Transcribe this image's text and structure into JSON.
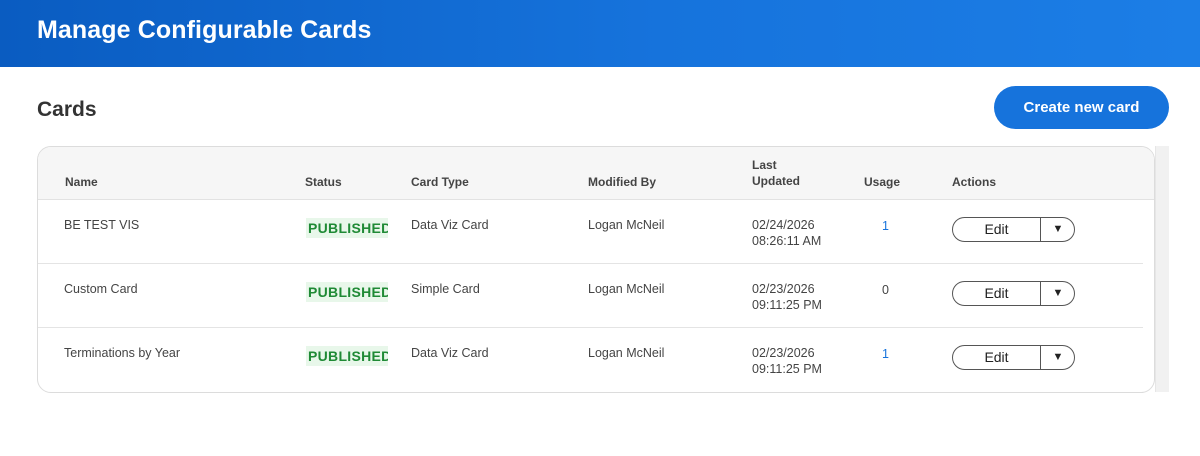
{
  "header": {
    "title": "Manage Configurable Cards"
  },
  "section": {
    "title": "Cards",
    "create_button": "Create new card"
  },
  "table": {
    "columns": {
      "name": "Name",
      "status": "Status",
      "card_type": "Card Type",
      "modified_by": "Modified By",
      "last_updated_line1": "Last",
      "last_updated_line2": "Updated",
      "usage": "Usage",
      "actions": "Actions"
    },
    "rows": [
      {
        "name": "BE TEST VIS",
        "status": "PUBLISHED",
        "card_type": "Data Viz Card",
        "modified_by": "Logan McNeil",
        "date": "02/24/2026",
        "time": "08:26:11 AM",
        "usage": "1",
        "edit": "Edit",
        "caret": "▼"
      },
      {
        "name": "Custom Card",
        "status": "PUBLISHED",
        "card_type": "Simple Card",
        "modified_by": "Logan McNeil",
        "date": "02/23/2026",
        "time": "09:11:25 PM",
        "usage": "0",
        "edit": "Edit",
        "caret": "▼"
      },
      {
        "name": "Terminations by Year",
        "status": "PUBLISHED",
        "card_type": "Data Viz Card",
        "modified_by": "Logan McNeil",
        "date": "02/23/2026",
        "time": "09:11:25 PM",
        "usage": "1",
        "edit": "Edit",
        "caret": "▼"
      }
    ]
  },
  "colors": {
    "header_blue": "#1673dc",
    "published_green": "#1f8a35",
    "published_bg": "#e8f7ea",
    "link_blue": "#1673dc"
  }
}
